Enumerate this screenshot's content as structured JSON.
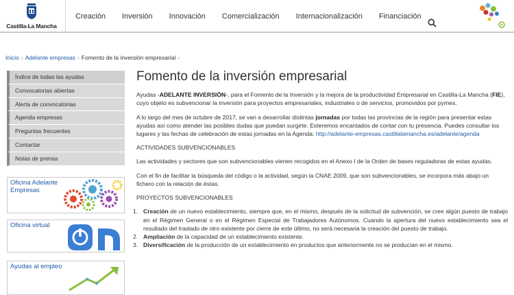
{
  "header": {
    "logo_text": "Castilla-La Mancha",
    "nav": [
      "Creación",
      "Inversión",
      "Innovación",
      "Comercialización",
      "Internacionalización",
      "Financiación"
    ]
  },
  "breadcrumb": {
    "items": [
      "Inicio",
      "Adelante empresas",
      "Fomento de la inversión empresarial"
    ]
  },
  "sidebar": {
    "items": [
      "Índice de todas las ayudas",
      "Convocatorias abiertas",
      "Alerta de convocatorias",
      "Agenda empresas",
      "Preguntas frecuentes",
      "Contactar",
      "Notas de prensa"
    ],
    "promos": [
      {
        "label": "Oficina Adelante Empresas"
      },
      {
        "label": "Oficina virtual"
      },
      {
        "label": "Ayudas al empleo"
      }
    ]
  },
  "main": {
    "title": "Fomento de la inversión empresarial",
    "p1_a": "Ayudas -",
    "p1_b": "ADELANTE INVERSIÓN",
    "p1_c": "-, para el Fomento de la Inversión y la mejora de la productividad Empresarial en Castilla-La Mancha (",
    "p1_d": "FIE",
    "p1_e": "), cuyo objeto es subvencionar la inversión para proyectos empresariales, industriales o de servicios, promovidos por pymes.",
    "p2_a": "A lo largo del mes de octubre de 2017, se van a desarrollar distintas ",
    "p2_b": "jornadas",
    "p2_c": " por todas las provincias de la región para presentar estas ayudas así como atender las posibles dudas que puedan surgirte. Esteremos encantados de contar con tu presencia. Puedes consultar los lugares y las fechas de celebración de estas jornadas en la Agenda: ",
    "p2_link": "http://adelante-empresas.castillalamancha.es/adelante/agenda",
    "h1": "ACTIVIDADES SUBVENCIONABLES",
    "p3": "Las actividades y sectores que son subvencionables vienen recogidos en el Anexo I de la Orden de bases reguladoras de estas ayudas.",
    "p4": "Con el fin de facilitar la búsqueda del código o la actividad, según la CNAE 2009, que son subvencionables, se incorpora más abajo un fichero con la relación de éstas.",
    "h2": "PROYECTOS SUBVENCIONABLES",
    "list": [
      {
        "num": "1.",
        "bold": "Creación",
        "text": " de un nuevo establecimiento, siempre que, en el mismo, después de la solicitud de subvención, se cree algún puesto de trabajo en el Régimen General o en el Régimen Especial de Trabajadores Autónomos. Cuando la apertura del nuevo establecimiento sea el resultado del traslado de otro existente por cierre de este último, no será necesaria la creación del puesto de trabajo."
      },
      {
        "num": "2.",
        "bold": "Ampliación",
        "text": " de la capacidad de un establecimiento existente."
      },
      {
        "num": "3.",
        "bold": "Diversificación",
        "text": " de la producción de un establecimiento en productos que anteriormente no se producían en el mismo."
      }
    ]
  }
}
